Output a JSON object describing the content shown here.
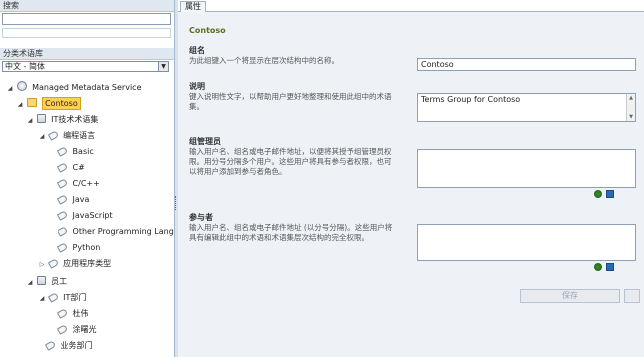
{
  "left": {
    "search_header": "搜索",
    "search_value": "",
    "tree_header": "分类术语库",
    "language": "中文 - 简体",
    "tree": [
      {
        "label": "Managed Metadata Service",
        "icon": "service-icon",
        "expander": "◢"
      },
      {
        "label": "Contoso",
        "icon": "group-icon",
        "expander": "◢",
        "selected": true
      },
      {
        "label": "IT技术术语集",
        "icon": "termset-icon",
        "expander": "◢"
      },
      {
        "label": "编程语言",
        "icon": "term-icon",
        "expander": "◢"
      },
      {
        "label": "Basic",
        "icon": "term-icon"
      },
      {
        "label": "C#",
        "icon": "term-icon"
      },
      {
        "label": "C/C++",
        "icon": "term-icon"
      },
      {
        "label": "Java",
        "icon": "term-icon"
      },
      {
        "label": "JavaScript",
        "icon": "term-icon"
      },
      {
        "label": "Other Programming Langu",
        "icon": "term-icon"
      },
      {
        "label": "Python",
        "icon": "term-icon"
      },
      {
        "label": "应用程序类型",
        "icon": "term-icon",
        "expander": "▷"
      },
      {
        "label": "员工",
        "icon": "termset-icon",
        "expander": "◢"
      },
      {
        "label": "IT部门",
        "icon": "term-icon",
        "expander": "◢"
      },
      {
        "label": "杜伟",
        "icon": "term-icon"
      },
      {
        "label": "涂曙光",
        "icon": "term-icon"
      },
      {
        "label": "业务部门",
        "icon": "term-icon"
      }
    ]
  },
  "right": {
    "tab": "属性",
    "title": "Contoso",
    "sections": {
      "name": {
        "title": "组名",
        "desc": "为此组键入一个将显示在层次结构中的名称。",
        "value": "Contoso"
      },
      "description": {
        "title": "说明",
        "desc": "键入说明性文字，以帮助用户更好地整理和使用此组中的术语集。",
        "value": "Terms Group for Contoso"
      },
      "managers": {
        "title": "组管理员",
        "desc": "输入用户名、组名或电子邮件地址，以便将其授予组管理员权限。用分号分隔多个用户。这些用户将具有参与者权限，也可以将用户添加到参与者角色。",
        "value": ""
      },
      "contributors": {
        "title": "参与者",
        "desc": "输入用户名、组名或电子邮件地址 (以分号分隔)。这些用户将具有编辑此组中的术语和术语集层次结构的完全权限。",
        "value": ""
      }
    },
    "save_label": "保存"
  }
}
